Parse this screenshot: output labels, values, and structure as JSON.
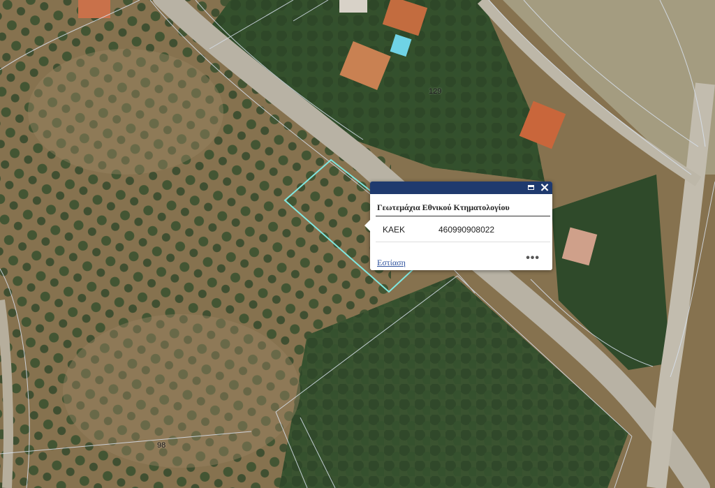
{
  "map": {
    "parcel_labels": [
      "129",
      "98"
    ],
    "colors": {
      "ground": "#8a7656",
      "vegetation": "#2f4a2a",
      "road": "#b9b3a6",
      "parcel_lines": "#d9e2ef",
      "selection": "#7fe7e0"
    }
  },
  "popup": {
    "title": "Γεωτεμάχια Εθνικού Κτηματολογίου",
    "attributes": [
      {
        "name": "ΚΑΕΚ",
        "value": "460990908022"
      }
    ],
    "zoom_link": "Εστίαση",
    "more_label": "•••",
    "close_icon": "×",
    "title_bar_color": "#1f3a6e"
  }
}
